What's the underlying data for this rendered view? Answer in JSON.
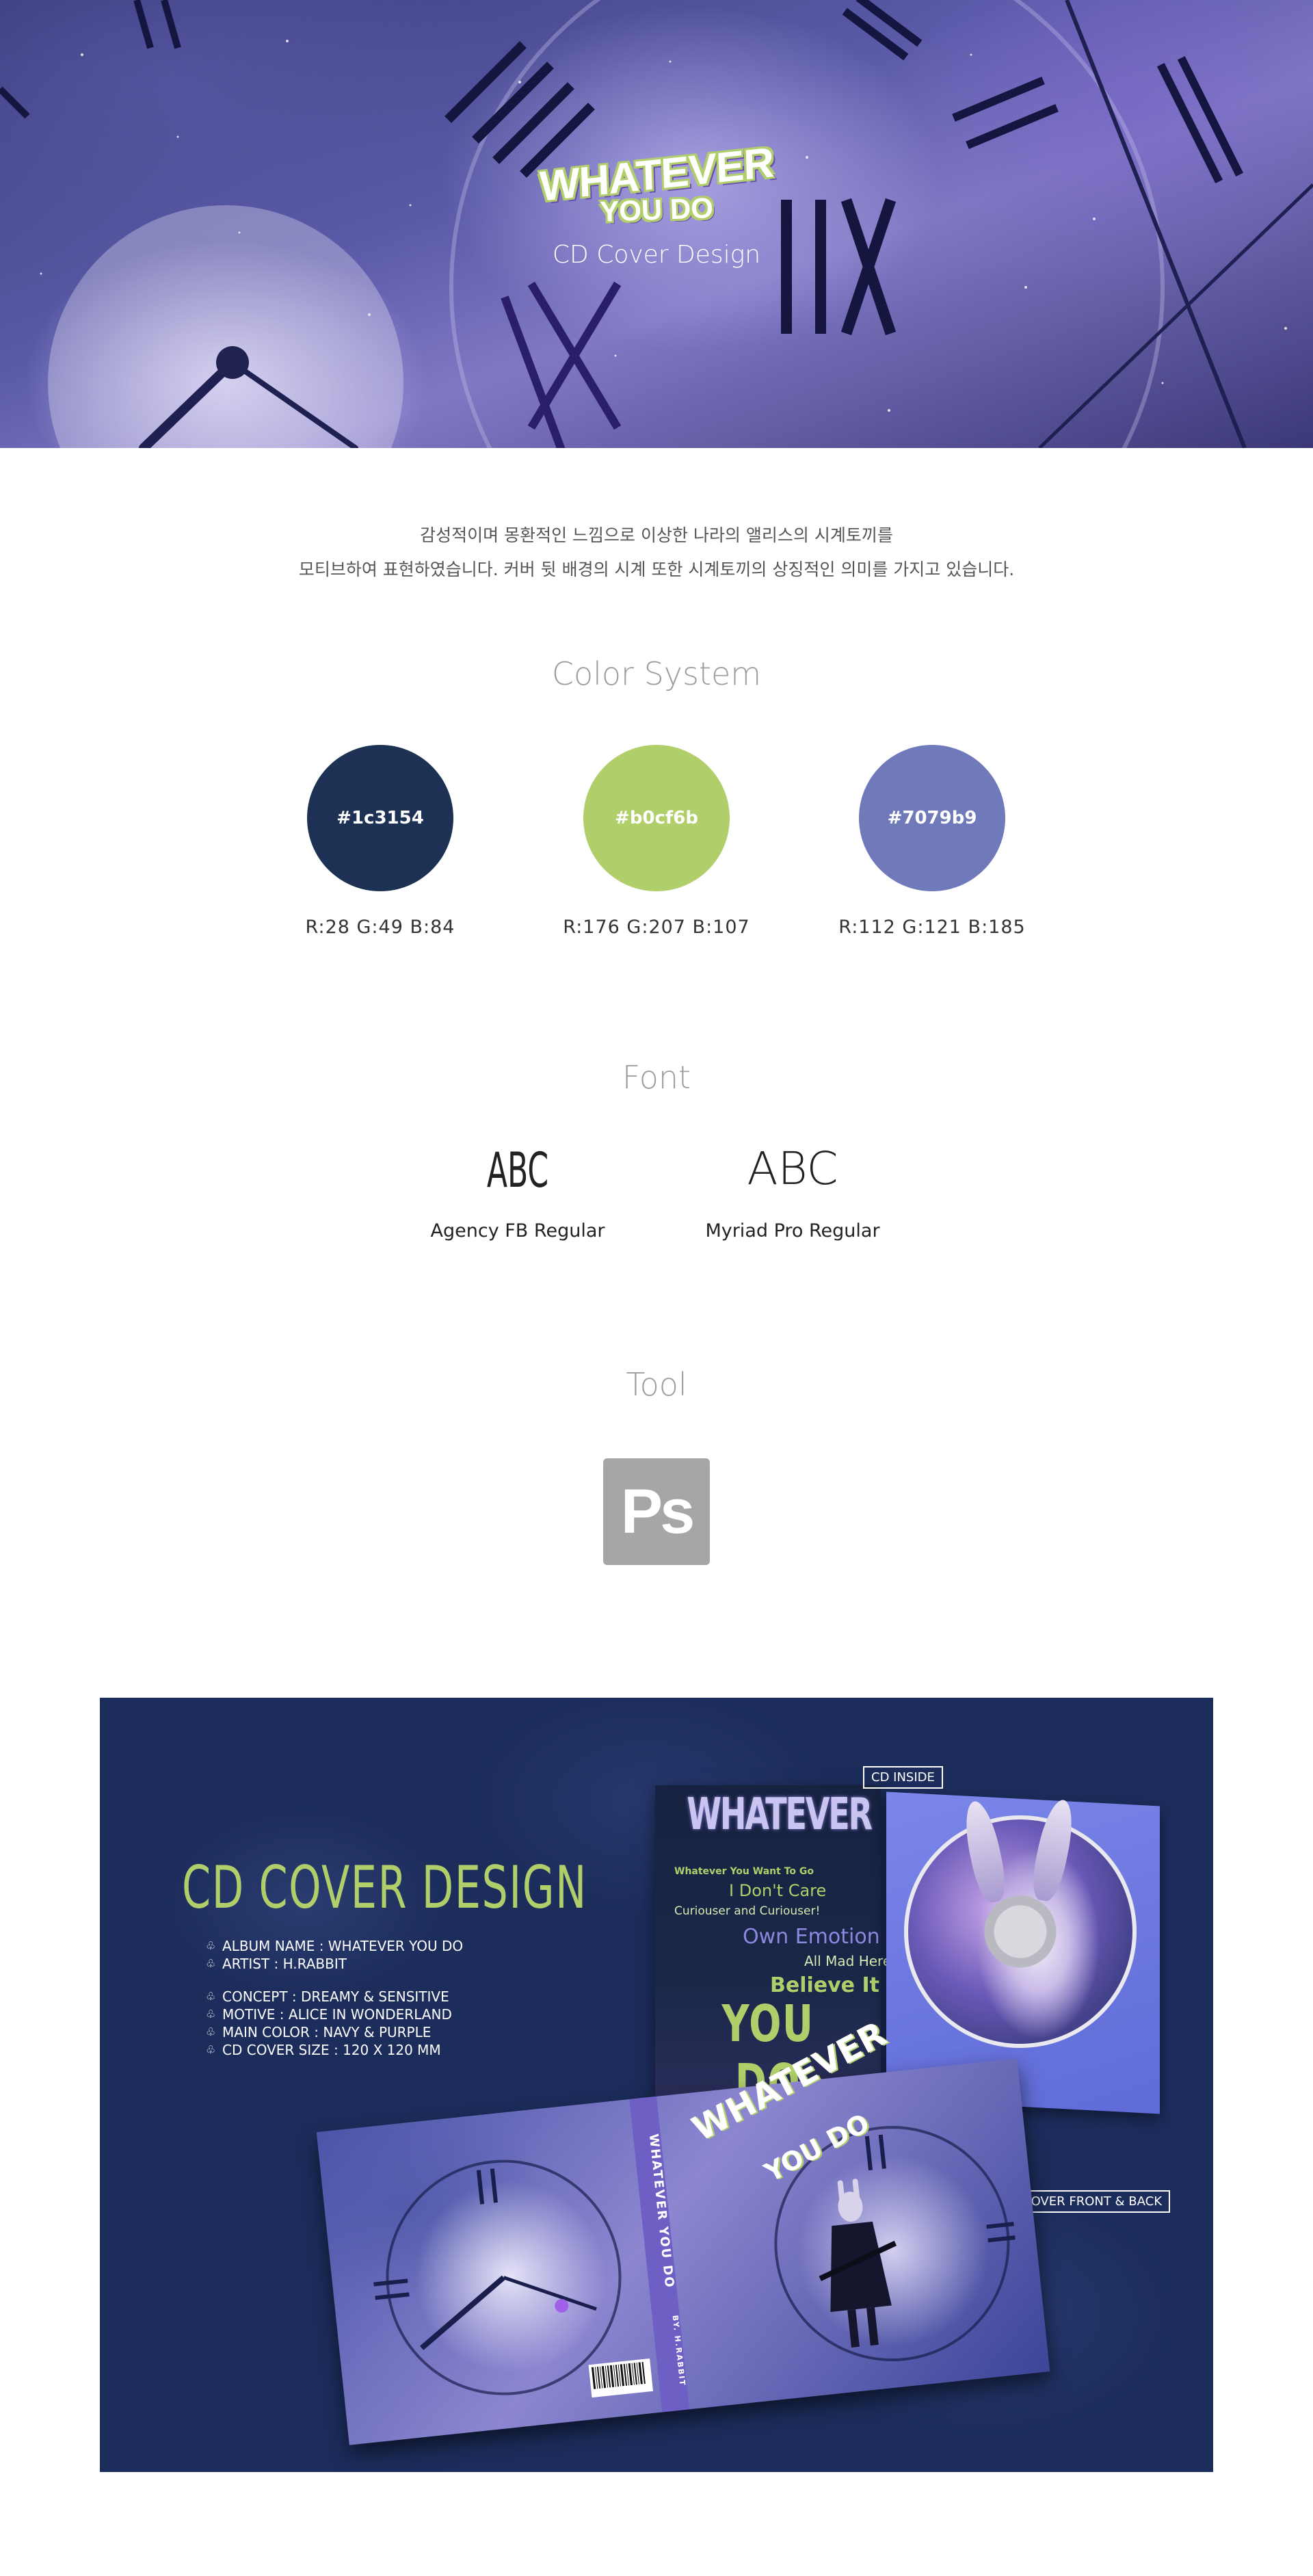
{
  "hero": {
    "logo_line1": "WHATEVER",
    "logo_line2": "YOU DO",
    "subtitle": "CD Cover Design",
    "clock_numerals": [
      "XII",
      "XI",
      "X",
      "I",
      "II"
    ]
  },
  "description": {
    "line1": "감성적이며 몽환적인 느낌으로 이상한 나라의 앨리스의 시계토끼를",
    "line2": "모티브하여 표현하였습니다. 커버 뒷 배경의 시계 또한 시계토끼의 상징적인 의미를 가지고 있습니다."
  },
  "color_system": {
    "title": "Color System",
    "swatches": [
      {
        "hex": "#1c3154",
        "label": "#1c3154",
        "rgb": "R:28 G:49 B:84"
      },
      {
        "hex": "#b0cf6b",
        "label": "#b0cf6b",
        "rgb": "R:176 G:207 B:107"
      },
      {
        "hex": "#7079b9",
        "label": "#7079b9",
        "rgb": "R:112 G:121 B:185"
      }
    ]
  },
  "font": {
    "title": "Font",
    "samples": [
      {
        "sample": "ABC",
        "name": "Agency FB Regular"
      },
      {
        "sample": "ABC",
        "name": "Myriad Pro Regular"
      }
    ]
  },
  "tool": {
    "title": "Tool",
    "icon_label": "Ps",
    "icon_name": "photoshop-icon"
  },
  "mockup": {
    "title": "CD COVER DESIGN",
    "specs_group1": [
      "ALBUM NAME : WHATEVER YOU DO",
      "ARTIST : H.RABBIT"
    ],
    "specs_group2": [
      "CONCEPT : DREAMY & SENSITIVE",
      "MOTIVE : ALICE IN WONDERLAND",
      "MAIN COLOR : NAVY & PURPLE",
      "CD COVER SIZE : 120 X 120 MM"
    ],
    "tag_inside": "CD INSIDE",
    "tag_cover": "COVER FRONT & BACK",
    "booklet": {
      "title": "WHATEVER",
      "lines": [
        "Whatever You Want To Go",
        "I Don't Care",
        "Curiouser and Curiouser!",
        "Own Emotion",
        "All Mad Here",
        "Believe It"
      ],
      "bottom": "YOU DO"
    },
    "spine_text": "WHATEVER YOU DO",
    "spine_artist": "BY. H.RABBIT",
    "cover_title": "WHATEVER",
    "cover_sub": "YOU DO"
  },
  "colors": {
    "navy": "#1c3154",
    "green": "#b0cf6b",
    "purple": "#7079b9",
    "title_gray": "#9e9e9e"
  }
}
